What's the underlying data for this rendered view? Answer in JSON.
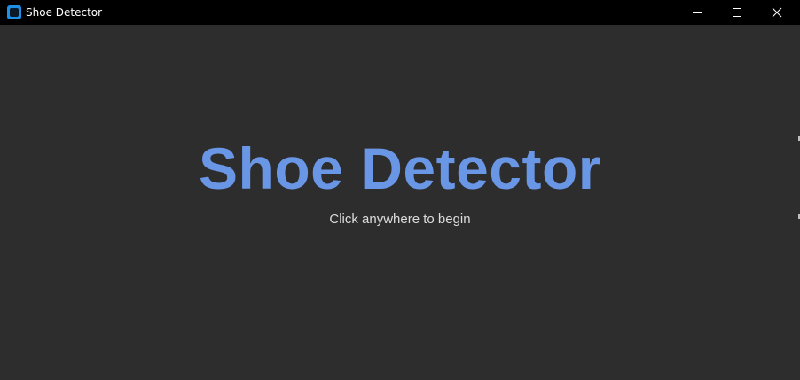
{
  "window": {
    "title": "Shoe Detector",
    "icon": "app-icon",
    "controls": {
      "minimize_icon": "minimize-icon",
      "maximize_icon": "maximize-icon",
      "close_icon": "close-icon"
    }
  },
  "splash": {
    "heading": "Shoe Detector",
    "prompt": "Click anywhere to begin"
  },
  "colors": {
    "titlebar_bg": "#000000",
    "content_bg": "#2d2d2d",
    "heading": "#6a96e6",
    "prompt": "#dcdcdc"
  }
}
